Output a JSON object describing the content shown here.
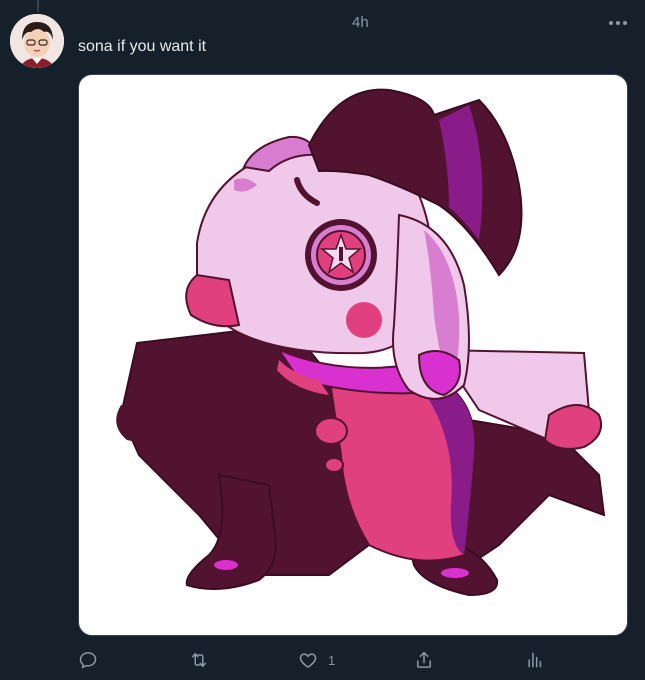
{
  "post": {
    "timestamp": "4h",
    "caption": "sona if you want it",
    "avatar_icon": "user-avatar",
    "more_icon": "more-horizontal-icon"
  },
  "media": {
    "description_icon": "sona-character-artwork",
    "colors": {
      "dark_maroon": "#521330",
      "light_pink": "#f0c8ea",
      "mid_pink": "#d87ed0",
      "magenta": "#d930d0",
      "hot_pink": "#e0407e",
      "purple": "#8a1c8a"
    }
  },
  "actions": {
    "reply_icon": "reply-icon",
    "retweet_icon": "retweet-icon",
    "like_icon": "heart-icon",
    "like_count": "1",
    "share_icon": "share-icon",
    "analytics_icon": "analytics-icon"
  },
  "theme": {
    "background": "#15202b",
    "text": "#e7e9ea",
    "muted": "#8b98a5",
    "border": "#38444d"
  }
}
